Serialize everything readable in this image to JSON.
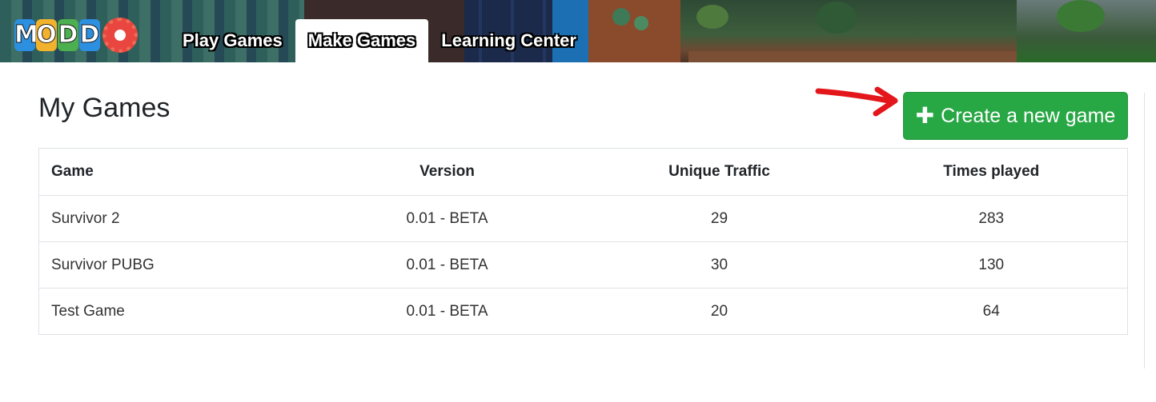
{
  "header": {
    "logo_text": "MODD",
    "nav": [
      {
        "label": "Play Games",
        "active": false
      },
      {
        "label": "Make Games",
        "active": true
      },
      {
        "label": "Learning Center",
        "active": false
      }
    ]
  },
  "main": {
    "title": "My Games",
    "create_button": {
      "icon": "plus-icon",
      "label": "Create a new game"
    },
    "table": {
      "columns": [
        "Game",
        "Version",
        "Unique Traffic",
        "Times played"
      ],
      "rows": [
        {
          "game": "Survivor 2",
          "version": "0.01 - BETA",
          "traffic": "29",
          "played": "283"
        },
        {
          "game": "Survivor PUBG",
          "version": "0.01 - BETA",
          "traffic": "30",
          "played": "130"
        },
        {
          "game": "Test Game",
          "version": "0.01 - BETA",
          "traffic": "20",
          "played": "64"
        }
      ]
    }
  },
  "colors": {
    "accent": "#28a745",
    "annotation_arrow": "#e3161b",
    "text": "#212529",
    "border": "#dee2e6"
  }
}
